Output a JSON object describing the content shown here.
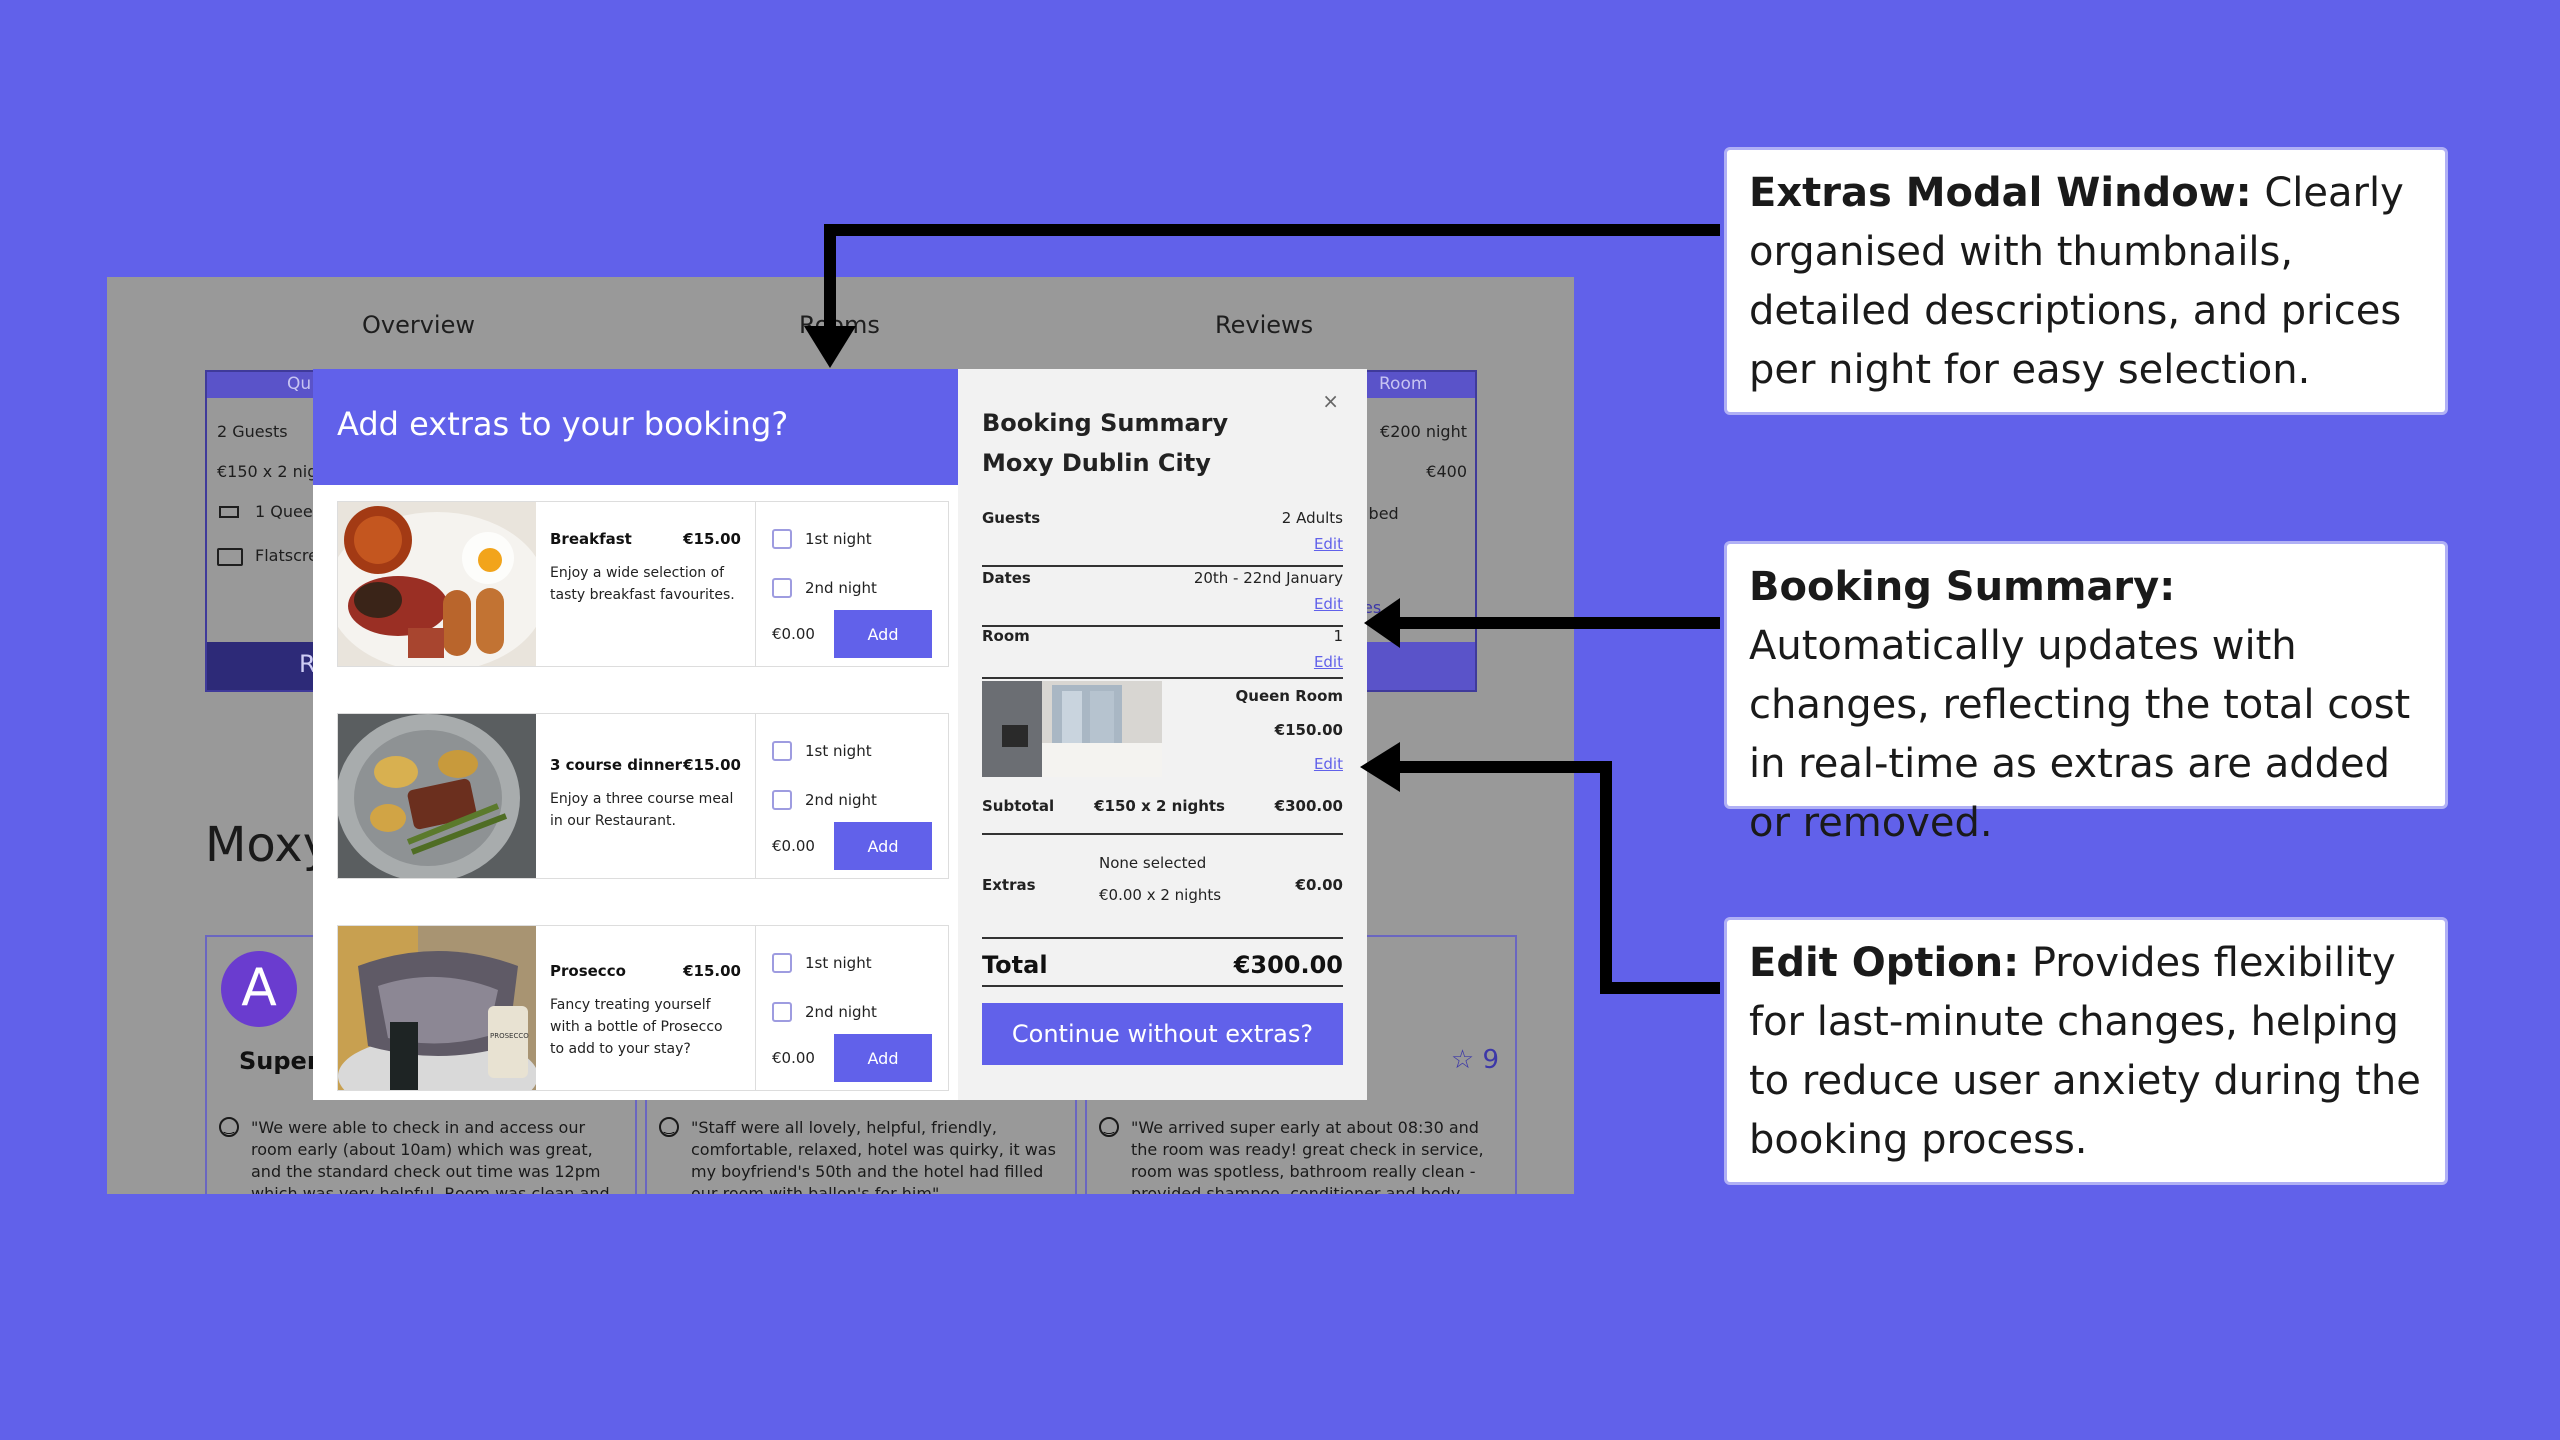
{
  "background_page": {
    "tabs": [
      "Overview",
      "Rooms",
      "Reviews"
    ],
    "left_room_card": {
      "header_partial": "Qu",
      "guests": "2 Guests",
      "price_partial": "€150 x 2 nigh",
      "bed_partial": "1 Queen",
      "tv_partial": "Flatscre",
      "footer_partial": "R"
    },
    "right_room_card": {
      "header_partial": "Room",
      "night_price": "€200 night",
      "total": "€400",
      "bed_partial": "ble bed",
      "link_partial": "ilities",
      "footer_partial": "e"
    },
    "title_partial": "Moxy",
    "reviews": [
      {
        "avatar_letter": "A",
        "rating_partial": "Superb",
        "text": "\"We were able to check in and access our room early (about 10am) which was great, and the standard check out time was 12pm which was very helpful. Room was clean and"
      },
      {
        "text": "\"Staff were all lovely, helpful, friendly, comfortable, relaxed, hotel was quirky, it was my boyfriend's 50th and the hotel had filled our room with ballon's for him\""
      },
      {
        "score": "9",
        "text": "\"We arrived super early at about 08:30 and the room was ready! great check in service, room was spotless, bathroom really clean - provided shampoo, conditioner and body"
      }
    ]
  },
  "extras_modal": {
    "title": "Add extras to your booking?",
    "items": [
      {
        "name": "Breakfast",
        "price": "€15.00",
        "description": "Enjoy a wide selection of tasty breakfast favourites.",
        "options": [
          "1st night",
          "2nd night"
        ],
        "amount": "€0.00",
        "button": "Add"
      },
      {
        "name": "3 course dinner",
        "price": "€15.00",
        "description": "Enjoy a three course meal in our Restaurant.",
        "options": [
          "1st night",
          "2nd night"
        ],
        "amount": "€0.00",
        "button": "Add"
      },
      {
        "name": "Prosecco",
        "price": "€15.00",
        "description": "Fancy treating yourself with a bottle of Prosecco to add to your stay?",
        "options": [
          "1st night",
          "2nd night"
        ],
        "amount": "€0.00",
        "button": "Add",
        "bottle_label": "PROSECCO"
      }
    ]
  },
  "booking_summary": {
    "close": "×",
    "title": "Booking Summary",
    "hotel": "Moxy Dublin City",
    "rows": [
      {
        "label": "Guests",
        "value": "2 Adults",
        "edit": "Edit"
      },
      {
        "label": "Dates",
        "value": "20th - 22nd January",
        "edit": "Edit"
      },
      {
        "label": "Room",
        "value": "1",
        "edit": "Edit"
      }
    ],
    "room": {
      "name": "Queen Room",
      "price": "€150.00",
      "edit": "Edit"
    },
    "subtotal": {
      "label": "Subtotal",
      "calc": "€150 x 2 nights",
      "value": "€300.00"
    },
    "extras": {
      "label": "Extras",
      "selected": "None selected",
      "calc": "€0.00 x 2 nights",
      "value": "€0.00"
    },
    "total": {
      "label": "Total",
      "value": "€300.00"
    },
    "continue_button": "Continue without extras?"
  },
  "annotations": [
    {
      "heading": "Extras Modal Window:",
      "text": " Clearly organised with thumbnails, detailed descriptions, and prices per night for easy selection."
    },
    {
      "heading": "Booking Summary:",
      "text": " Automatically updates with changes, reflecting the total cost in real-time as extras are added or removed."
    },
    {
      "heading": "Edit Option:",
      "text": " Provides flexibility for last-minute changes, helping to reduce user anxiety during the booking process."
    }
  ],
  "colors": {
    "background": "#6161ea",
    "accent": "#6161ea",
    "overlay": "#999999",
    "summary_bg": "#f2f2f2"
  }
}
